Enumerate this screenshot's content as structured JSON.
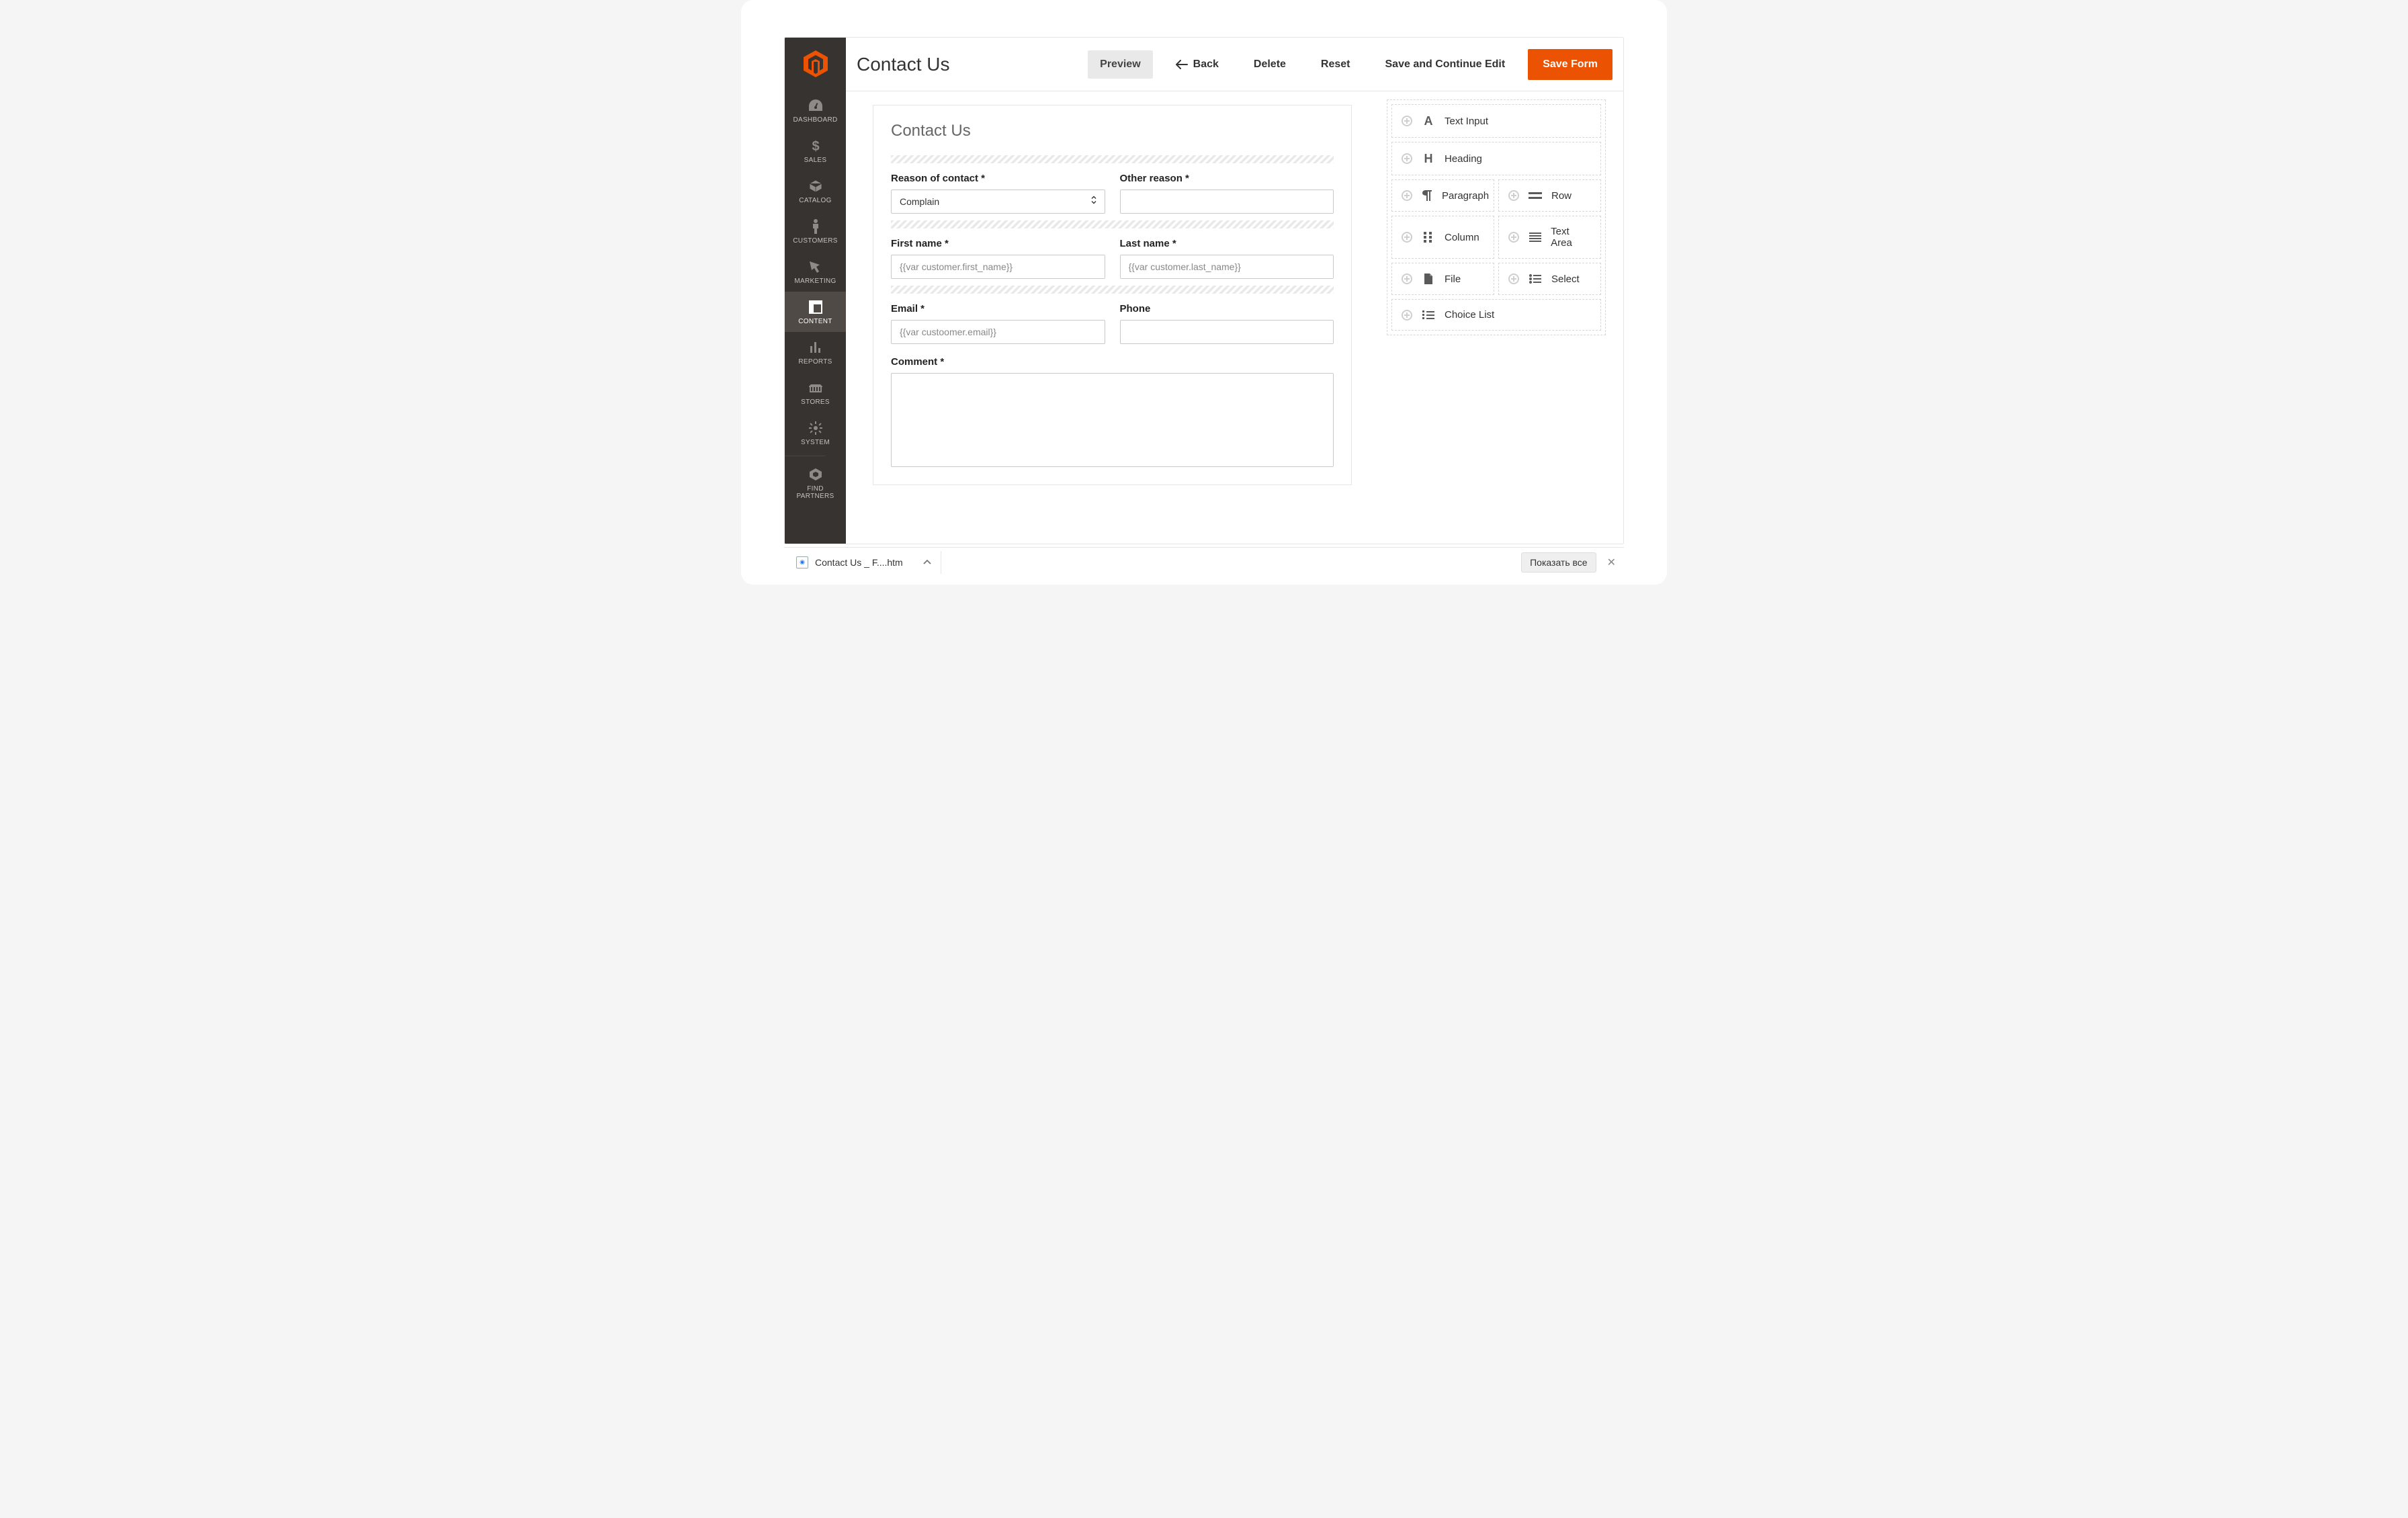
{
  "page_title": "Contact Us",
  "topbar": {
    "preview": "Preview",
    "back": "Back",
    "delete": "Delete",
    "reset": "Reset",
    "save_continue": "Save and Continue Edit",
    "save_form": "Save Form"
  },
  "sidebar": {
    "items": [
      {
        "label": "DASHBOARD"
      },
      {
        "label": "SALES"
      },
      {
        "label": "CATALOG"
      },
      {
        "label": "CUSTOMERS"
      },
      {
        "label": "MARKETING"
      },
      {
        "label": "CONTENT"
      },
      {
        "label": "REPORTS"
      },
      {
        "label": "STORES"
      },
      {
        "label": "SYSTEM"
      },
      {
        "label": "FIND PARTNERS"
      }
    ],
    "active_index": 5
  },
  "form": {
    "title": "Contact Us",
    "reason_label": "Reason of contact *",
    "reason_value": "Complain",
    "other_label": "Other reason *",
    "other_value": "",
    "first_name_label": "First name *",
    "first_name_placeholder": "{{var customer.first_name}}",
    "last_name_label": "Last name *",
    "last_name_placeholder": "{{var customer.last_name}}",
    "email_label": "Email *",
    "email_placeholder": "{{var custoomer.email}}",
    "phone_label": "Phone",
    "phone_value": "",
    "comment_label": "Comment *",
    "comment_value": ""
  },
  "widgets": [
    {
      "label": "Text Input",
      "size": "full",
      "icon": "text"
    },
    {
      "label": "Heading",
      "size": "full",
      "icon": "heading"
    },
    {
      "label": "Paragraph",
      "size": "half",
      "icon": "paragraph"
    },
    {
      "label": "Row",
      "size": "half",
      "icon": "row"
    },
    {
      "label": "Column",
      "size": "half",
      "icon": "column"
    },
    {
      "label": "Text Area",
      "size": "half",
      "icon": "textarea"
    },
    {
      "label": "File",
      "size": "half",
      "icon": "file"
    },
    {
      "label": "Select",
      "size": "half",
      "icon": "select"
    },
    {
      "label": "Choice List",
      "size": "full",
      "icon": "choicelist"
    }
  ],
  "downloads": {
    "file_name": "Contact Us _ F....htm",
    "show_all": "Показать все"
  }
}
